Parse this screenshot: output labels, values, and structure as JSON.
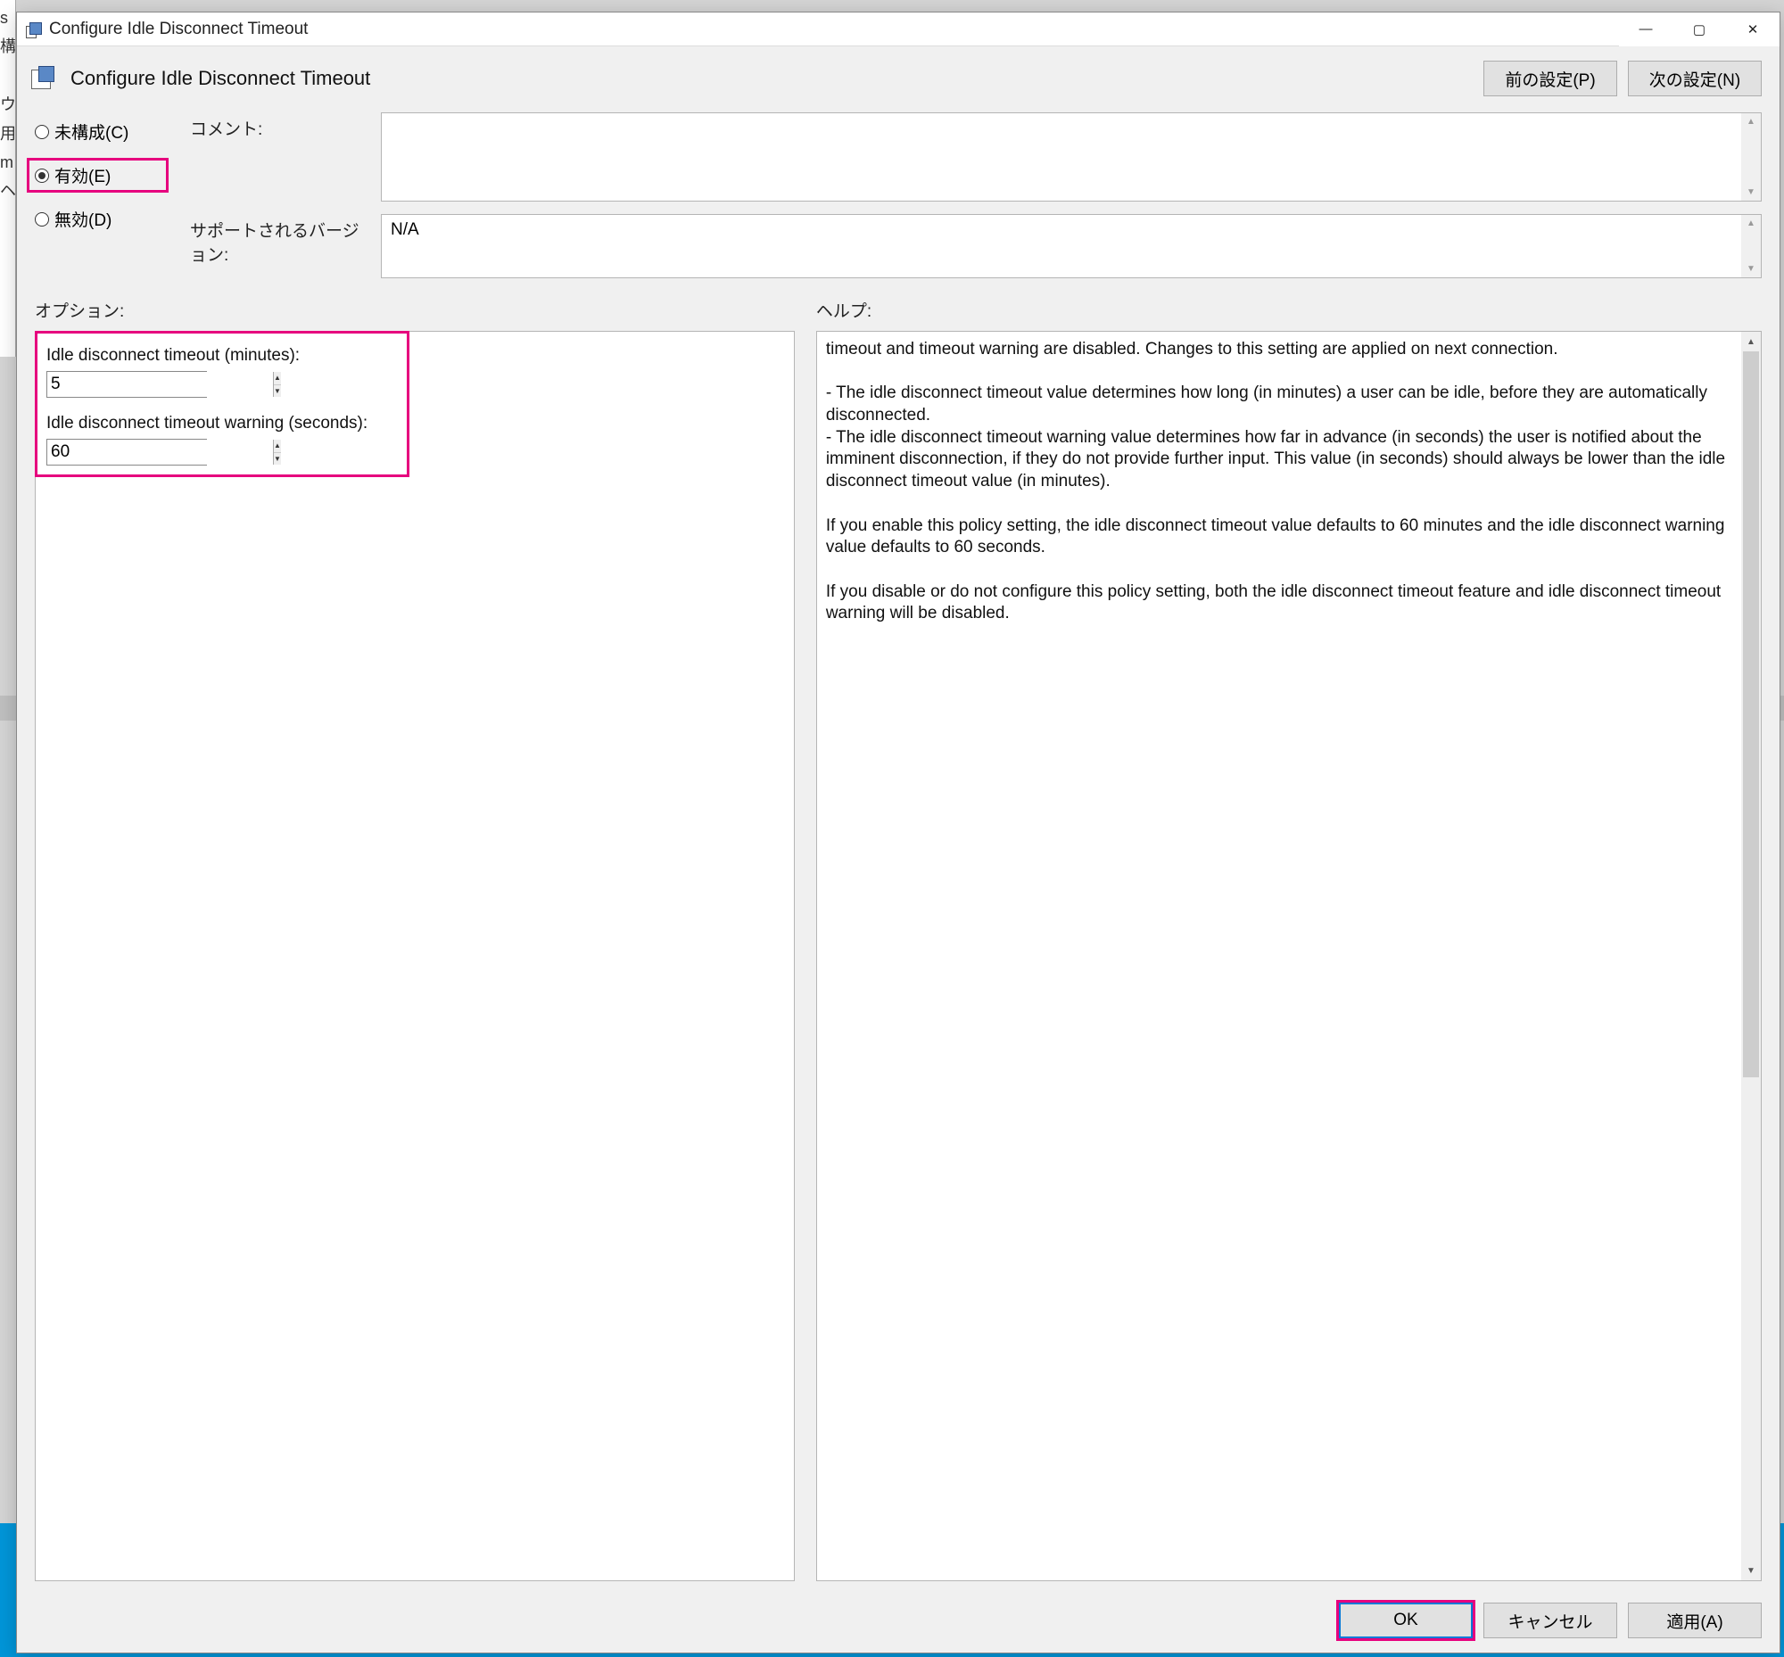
{
  "window": {
    "title": "Configure Idle Disconnect Timeout"
  },
  "header": {
    "setting_title": "Configure Idle Disconnect Timeout",
    "prev_button": "前の設定(P)",
    "next_button": "次の設定(N)"
  },
  "radios": {
    "not_configured": "未構成(C)",
    "enabled": "有効(E)",
    "disabled": "無効(D)",
    "selected": "enabled"
  },
  "labels": {
    "comment": "コメント:",
    "supported": "サポートされるバージョン:",
    "options": "オプション:",
    "help": "ヘルプ:"
  },
  "supported_value": "N/A",
  "options": {
    "idle_timeout_label": "Idle disconnect timeout (minutes):",
    "idle_timeout_value": "5",
    "idle_warning_label": "Idle disconnect timeout warning (seconds):",
    "idle_warning_value": "60"
  },
  "help_text": "timeout and timeout warning are disabled. Changes to this setting are applied on next connection.\n\n- The idle disconnect timeout value determines how long (in minutes) a user can be idle, before they are automatically disconnected.\n- The idle disconnect timeout warning value determines how far in advance (in seconds) the user is notified about the imminent disconnection, if they do not provide further input. This value (in seconds) should always be lower than the idle disconnect timeout value (in minutes).\n\nIf you enable this policy setting, the idle disconnect timeout value defaults to 60 minutes and the idle disconnect warning value defaults to 60 seconds.\n\nIf you disable or do not configure this policy setting, both the idle disconnect timeout feature and idle disconnect timeout warning will be disabled.",
  "footer": {
    "ok": "OK",
    "cancel": "キャンセル",
    "apply": "適用(A)"
  }
}
